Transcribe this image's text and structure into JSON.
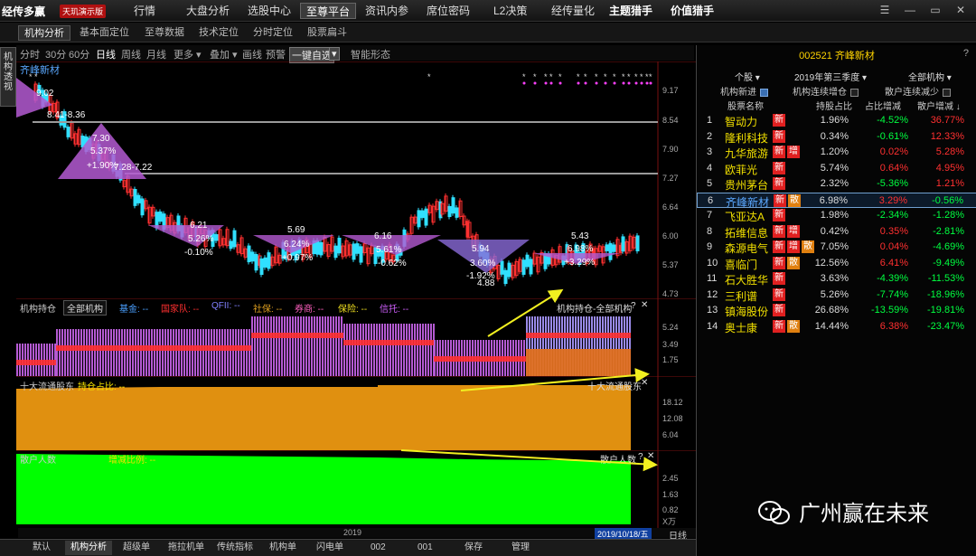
{
  "app": {
    "logo": "经传多赢",
    "badge": "天玑演示版"
  },
  "topnav": [
    "行情",
    "大盘分析",
    "选股中心",
    "至尊平台",
    "资讯内参",
    "席位密码",
    "L2决策",
    "经传量化",
    "主题猎手",
    "价值猎手"
  ],
  "window_controls": [
    "☰",
    "—",
    "▭",
    "✕"
  ],
  "subtabs": [
    "机构分析",
    "基本面定位",
    "至尊数据",
    "技术定位",
    "分时定位",
    "股票扁斗"
  ],
  "lefttab": "机构透视",
  "periods": [
    "分时",
    "30分",
    "60分",
    "日线",
    "周线",
    "月线",
    "更多 ▾",
    "叠加 ▾",
    "画线",
    "预警",
    "一键自选",
    "▾",
    "智能形态"
  ],
  "stock_name": "齐峰新材",
  "price_axis": [
    "9.17",
    "8.54",
    "7.90",
    "7.27",
    "6.64",
    "6.00",
    "5.37",
    "4.73"
  ],
  "kline_labels": [
    {
      "t": "9.02"
    },
    {
      "t": "8.41-8.36"
    },
    {
      "t": "7.30"
    },
    {
      "t": "5.37%"
    },
    {
      "t": "+1.90%"
    },
    {
      "t": "7.28-7.22"
    },
    {
      "t": "6.21"
    },
    {
      "t": "5.26%"
    },
    {
      "t": "-0.10%"
    },
    {
      "t": "5.69"
    },
    {
      "t": "6.24%"
    },
    {
      "t": "+0.97%"
    },
    {
      "t": "6.16"
    },
    {
      "t": "5.61%"
    },
    {
      "t": "-0.62%"
    },
    {
      "t": "5.94"
    },
    {
      "t": "3.60%"
    },
    {
      "t": "-1.92%"
    },
    {
      "t": "4.88"
    },
    {
      "t": "5.43"
    },
    {
      "t": "6.98%"
    },
    {
      "t": "+3.29%"
    }
  ],
  "panel1": {
    "title": "机构持仓",
    "dropdown": "全部机构",
    "legend": [
      "基金: --",
      "国家队: --",
      "QFII: --",
      "社保: --",
      "券商: --",
      "保险: --",
      "信托: --"
    ],
    "right_label": "机构持仓-全部机构",
    "axis": [
      "5.24",
      "3.49",
      "1.75"
    ]
  },
  "panel2": {
    "title": "十大流通股东",
    "legend": "持仓占比: --",
    "right_label": "十大流通股东",
    "axis": [
      "18.12",
      "12.08",
      "6.04"
    ]
  },
  "panel3": {
    "title": "散户人数",
    "legend": [
      "散户人数: --",
      "增减比例: --"
    ],
    "right_label": "散户人数",
    "axis": [
      "2.45",
      "1.63",
      "0.82"
    ],
    "unit": "X万"
  },
  "date_axis": {
    "year": "2019",
    "current": "2019/10/18/五",
    "period": "日线"
  },
  "bottombar": [
    "默认",
    "机构分析",
    "超级单",
    "拖拉机单",
    "传统指标",
    "机构单",
    "闪电单",
    "002",
    "001",
    "保存",
    "管理"
  ],
  "right": {
    "code": "002521",
    "name": "齐峰新材",
    "help": "?",
    "selects": [
      "个股 ▾",
      "2019年第三季度 ▾",
      "全部机构 ▾"
    ],
    "checks": [
      {
        "label": "机构新进",
        "on": true
      },
      {
        "label": "机构连续增仓",
        "on": false
      },
      {
        "label": "散户连续减少",
        "on": false
      }
    ],
    "headers": [
      "股票名称",
      "持股占比",
      "占比增减",
      "散户增减 ↓"
    ],
    "rows": [
      {
        "idx": "1",
        "name": "智动力",
        "badges": [
          "新"
        ],
        "hold": "1.96%",
        "chg": "-4.52%",
        "ret": "36.77%"
      },
      {
        "idx": "2",
        "name": "隆利科技",
        "badges": [
          "新"
        ],
        "hold": "0.34%",
        "chg": "-0.61%",
        "ret": "12.33%"
      },
      {
        "idx": "3",
        "name": "九华旅游",
        "badges": [
          "新",
          "增"
        ],
        "hold": "1.20%",
        "chg": "0.02%",
        "ret": "5.28%"
      },
      {
        "idx": "4",
        "name": "欧菲光",
        "badges": [
          "新"
        ],
        "hold": "5.74%",
        "chg": "0.64%",
        "ret": "4.95%"
      },
      {
        "idx": "5",
        "name": "贵州茅台",
        "badges": [
          "新"
        ],
        "hold": "2.32%",
        "chg": "-5.36%",
        "ret": "1.21%"
      },
      {
        "idx": "6",
        "name": "齐峰新材",
        "badges": [
          "新",
          "散"
        ],
        "hold": "6.98%",
        "chg": "3.29%",
        "ret": "-0.56%"
      },
      {
        "idx": "7",
        "name": "飞亚达A",
        "badges": [
          "新"
        ],
        "hold": "1.98%",
        "chg": "-2.34%",
        "ret": "-1.28%"
      },
      {
        "idx": "8",
        "name": "拓维信息",
        "badges": [
          "新",
          "增"
        ],
        "hold": "0.42%",
        "chg": "0.35%",
        "ret": "-2.81%"
      },
      {
        "idx": "9",
        "name": "森源电气",
        "badges": [
          "新",
          "增",
          "散"
        ],
        "hold": "7.05%",
        "chg": "0.04%",
        "ret": "-4.69%"
      },
      {
        "idx": "10",
        "name": "喜临门",
        "badges": [
          "新",
          "散"
        ],
        "hold": "12.56%",
        "chg": "6.41%",
        "ret": "-9.49%"
      },
      {
        "idx": "11",
        "name": "石大胜华",
        "badges": [
          "新"
        ],
        "hold": "3.63%",
        "chg": "-4.39%",
        "ret": "-11.53%"
      },
      {
        "idx": "12",
        "name": "三利谱",
        "badges": [
          "新"
        ],
        "hold": "5.26%",
        "chg": "-7.74%",
        "ret": "-18.96%"
      },
      {
        "idx": "13",
        "name": "镇海股份",
        "badges": [
          "新"
        ],
        "hold": "26.68%",
        "chg": "-13.59%",
        "ret": "-19.81%"
      },
      {
        "idx": "14",
        "name": "奥士康",
        "badges": [
          "新",
          "散"
        ],
        "hold": "14.44%",
        "chg": "6.38%",
        "ret": "-23.47%"
      }
    ]
  },
  "watermark": "广州赢在未来",
  "colors": {
    "up": "#ff3030",
    "down": "#00ff60",
    "purple": "#b45ad2",
    "orange": "#e09010",
    "green": "#00ff00",
    "yellow": "#f2e000",
    "blue": "#5aa8ff"
  }
}
